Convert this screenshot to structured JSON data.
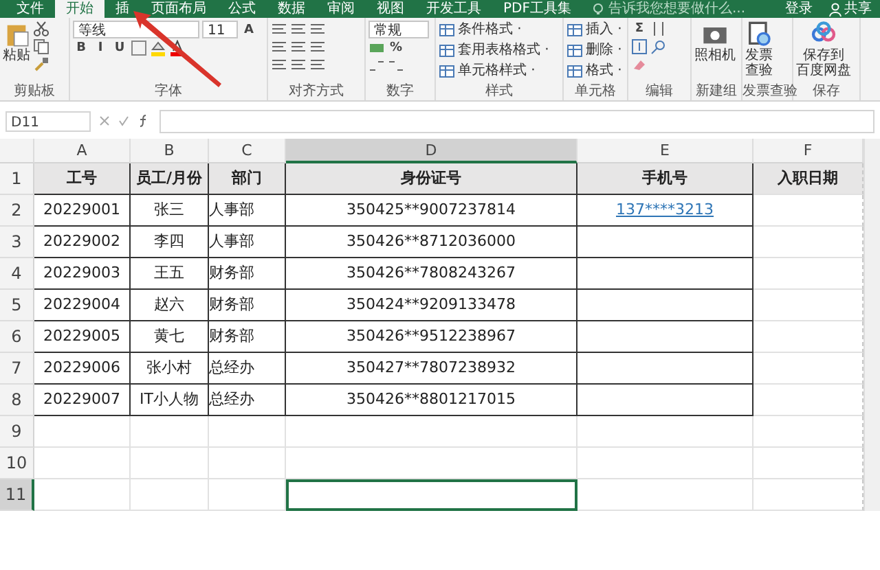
{
  "tabs": [
    {
      "label": "文件",
      "selected": false
    },
    {
      "label": "开始",
      "selected": true
    },
    {
      "label": "插",
      "selected": false
    },
    {
      "label": "页面布局",
      "selected": false
    },
    {
      "label": "公式",
      "selected": false
    },
    {
      "label": "数据",
      "selected": false
    },
    {
      "label": "审阅",
      "selected": false
    },
    {
      "label": "视图",
      "selected": false
    },
    {
      "label": "开发工具",
      "selected": false
    },
    {
      "label": "PDF工具集",
      "selected": false
    }
  ],
  "tell_me": {
    "placeholder": "告诉我您想要做什么..."
  },
  "login": "登录",
  "share": "共享",
  "ribbon": [
    {
      "kind": "clipboard",
      "label": "剪贴板",
      "texts": [
        "粘贴"
      ]
    },
    {
      "kind": "font",
      "label": "字体",
      "texts": [
        "等线",
        "11",
        "A",
        "B",
        "I",
        "U"
      ]
    },
    {
      "kind": "align",
      "label": "对齐方式"
    },
    {
      "kind": "number",
      "label": "数字",
      "texts": [
        "常规",
        "%"
      ]
    },
    {
      "kind": "styles",
      "label": "样式",
      "texts": [
        "条件格式 ·",
        "套用表格格式 ·",
        "单元格样式 ·"
      ]
    },
    {
      "kind": "cells",
      "label": "单元格",
      "texts": [
        "插入 ·",
        "删除 ·",
        "格式 ·"
      ]
    },
    {
      "kind": "editing",
      "label": "编辑",
      "texts": [
        "Σ"
      ]
    },
    {
      "kind": "camera",
      "label": "新建组",
      "texts": [
        "照相机"
      ]
    },
    {
      "kind": "invoice",
      "label": "发票查验",
      "texts": [
        "发票",
        "查验"
      ]
    },
    {
      "kind": "save",
      "label": "保存",
      "texts": [
        "保存到",
        "百度网盘"
      ]
    }
  ],
  "name_box": "D11",
  "columns": [
    {
      "label": "A",
      "selected": false
    },
    {
      "label": "B",
      "selected": false
    },
    {
      "label": "C",
      "selected": false
    },
    {
      "label": "D",
      "selected": true
    },
    {
      "label": "E",
      "selected": false
    },
    {
      "label": "F",
      "selected": false
    }
  ],
  "rows": [
    {
      "number": "1",
      "selected": false,
      "kind": "header",
      "cells": [
        "工号",
        "员工/月份",
        "部门",
        "身份证号",
        "手机号",
        "入职日期"
      ]
    },
    {
      "number": "2",
      "selected": false,
      "kind": "data",
      "cells": [
        "20229001",
        "张三",
        "人事部",
        "350425**9007237814",
        {
          "kind": "link",
          "text": "137****3213"
        },
        ""
      ]
    },
    {
      "number": "3",
      "selected": false,
      "kind": "data",
      "cells": [
        "20229002",
        "李四",
        "人事部",
        "350426**8712036000",
        "",
        ""
      ]
    },
    {
      "number": "4",
      "selected": false,
      "kind": "data",
      "cells": [
        "20229003",
        "王五",
        "财务部",
        "350426**7808243267",
        "",
        ""
      ]
    },
    {
      "number": "5",
      "selected": false,
      "kind": "data",
      "cells": [
        "20229004",
        "赵六",
        "财务部",
        "350424**9209133478",
        "",
        ""
      ]
    },
    {
      "number": "6",
      "selected": false,
      "kind": "data",
      "cells": [
        "20229005",
        "黄七",
        "财务部",
        "350426**9512238967",
        "",
        ""
      ]
    },
    {
      "number": "7",
      "selected": false,
      "kind": "data",
      "cells": [
        "20229006",
        "张小村",
        "总经办",
        "350427**7807238932",
        "",
        ""
      ]
    },
    {
      "number": "8",
      "selected": false,
      "kind": "data",
      "cells": [
        "20229007",
        "IT小人物",
        "总经办",
        "350426**8801217015",
        "",
        ""
      ]
    },
    {
      "number": "9",
      "selected": false,
      "kind": "empty",
      "cells": [
        "",
        "",
        "",
        "",
        "",
        ""
      ]
    },
    {
      "number": "10",
      "selected": false,
      "kind": "empty",
      "cells": [
        "",
        "",
        "",
        "",
        "",
        ""
      ]
    },
    {
      "number": "11",
      "selected": true,
      "kind": "empty",
      "cells": [
        "",
        "",
        "",
        "",
        "",
        ""
      ]
    }
  ]
}
